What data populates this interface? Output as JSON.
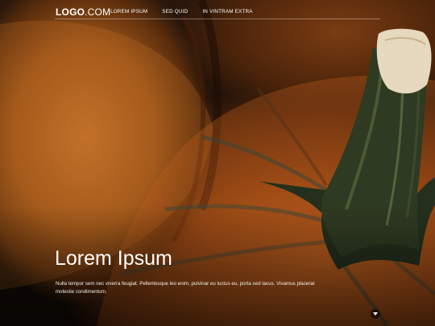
{
  "logo": {
    "bold": "LOGO",
    "rest": ".COM"
  },
  "nav": {
    "items": [
      {
        "label": "LOREM IPSUM"
      },
      {
        "label": "SED QUID"
      },
      {
        "label": "IN VINTRAM EXTRA"
      }
    ]
  },
  "hero": {
    "title": "Lorem Ipsum",
    "body": "Nulla tempor sem nec viverra feugiat. Pellentesque leo enim, pulvinar eu luctus eu, porta sed lacus. Vivamus placerat molestie condimentum."
  },
  "icons": {
    "scroll": "chevron-down-icon"
  },
  "colors": {
    "text": "#ffffff",
    "pumpkin": "#b85e1f",
    "stem": "#2f3a22"
  }
}
